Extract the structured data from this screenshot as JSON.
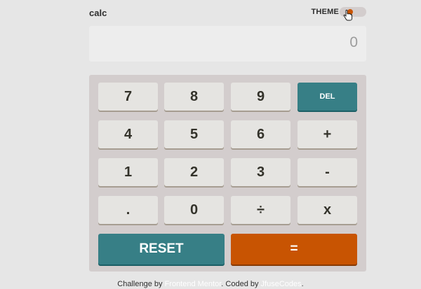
{
  "header": {
    "title": "calc",
    "theme_label": "THEME"
  },
  "display": {
    "value": "0"
  },
  "keypad": {
    "rows": [
      [
        "7",
        "8",
        "9",
        "DEL"
      ],
      [
        "4",
        "5",
        "6",
        "+"
      ],
      [
        "1",
        "2",
        "3",
        "-"
      ],
      [
        ".",
        "0",
        "÷",
        "x"
      ]
    ],
    "reset_label": "RESET",
    "equals_label": "="
  },
  "footer": {
    "prefix": "Challenge by ",
    "challenge_link": "Frontend Mentor",
    "middle": ". Coded by ",
    "author_link": "JfuseCodes",
    "suffix": "."
  },
  "colors": {
    "background": "#e6e6e6",
    "keypad_bg": "#d3cdcd",
    "key_bg": "#e5e4e1",
    "accent_teal": "#377f86",
    "accent_orange": "#c85402"
  }
}
